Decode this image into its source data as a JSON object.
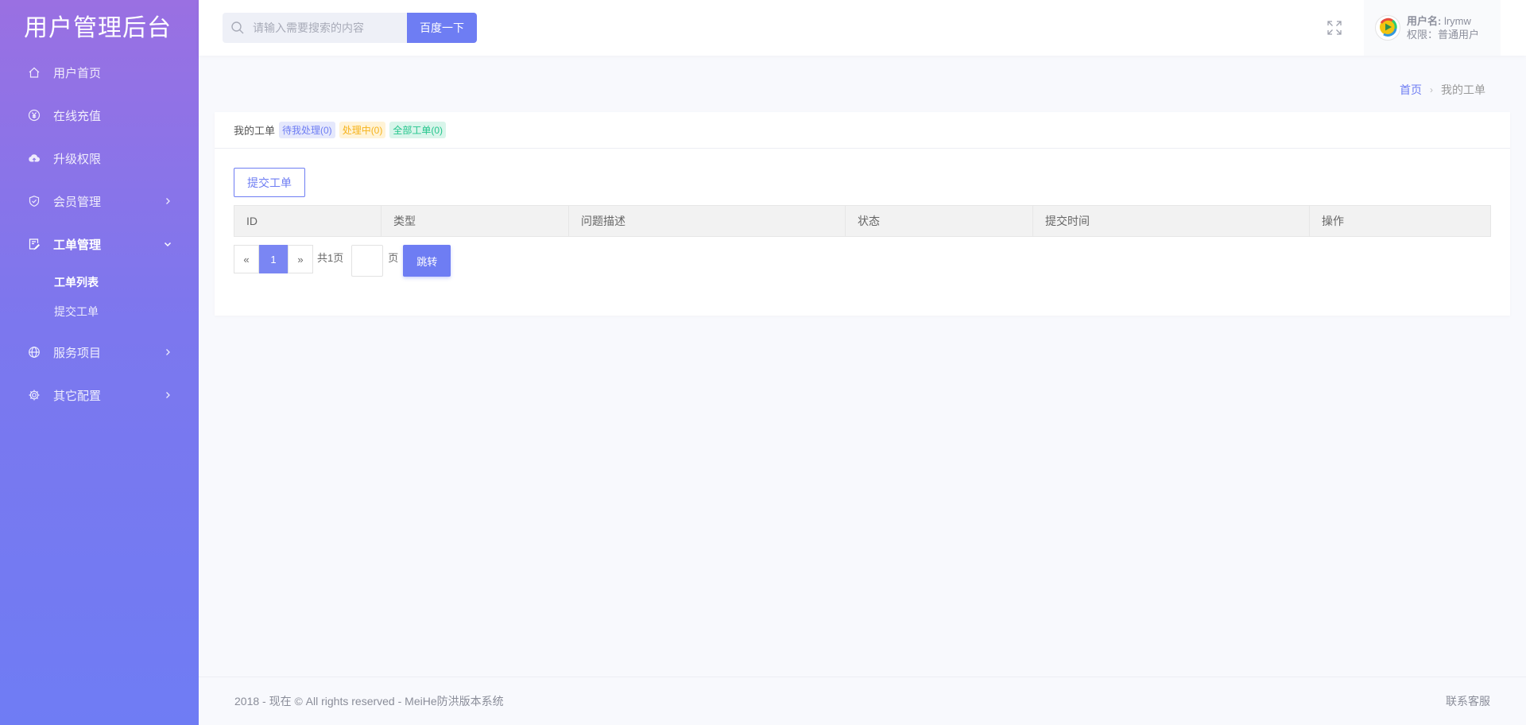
{
  "app": {
    "title": "用户管理后台"
  },
  "sidebar": {
    "items": [
      {
        "label": "用户首页",
        "icon": "home-icon",
        "has_caret": false
      },
      {
        "label": "在线充值",
        "icon": "yen-icon",
        "has_caret": false
      },
      {
        "label": "升级权限",
        "icon": "cloud-upload-icon",
        "has_caret": false
      },
      {
        "label": "会员管理",
        "icon": "shield-icon",
        "has_caret": true
      },
      {
        "label": "工单管理",
        "icon": "ticket-edit-icon",
        "has_caret": true,
        "expanded": true
      }
    ],
    "submenu": [
      {
        "label": "工单列表",
        "current": true
      },
      {
        "label": "提交工单",
        "current": false
      }
    ],
    "items_after": [
      {
        "label": "服务项目",
        "icon": "globe-icon",
        "has_caret": true
      },
      {
        "label": "其它配置",
        "icon": "gear-icon",
        "has_caret": true
      }
    ]
  },
  "header": {
    "search_placeholder": "请输入需要搜索的内容",
    "search_button": "百度一下",
    "user_name_label": "用户名:",
    "user_name": "lrymw",
    "user_role": "权限：普通用户"
  },
  "breadcrumb": {
    "home": "首页",
    "separator": "›",
    "current": "我的工单"
  },
  "card": {
    "title": "我的工单",
    "tags": [
      {
        "label": "待我处理(0)",
        "color": "#6e7df3"
      },
      {
        "label": "处理中(0)",
        "color": "#f6b31b"
      },
      {
        "label": "全部工单(0)",
        "color": "#23c58c"
      }
    ],
    "submit_button": "提交工单",
    "columns": [
      "ID",
      "类型",
      "问题描述",
      "状态",
      "提交时间",
      "操作"
    ]
  },
  "pagination": {
    "prev": "«",
    "current_page": "1",
    "next": "»",
    "total": "共1页",
    "unit": "页",
    "go_button": "跳转"
  },
  "footer": {
    "copyright": "2018 - 现在 © All rights reserved - MeiHe防洪版本系统",
    "contact": "联系客服"
  },
  "colors": {
    "accent": "#6e7df3",
    "sidebar_top": "#9a70e2",
    "sidebar_bottom": "#6f7cf4"
  }
}
